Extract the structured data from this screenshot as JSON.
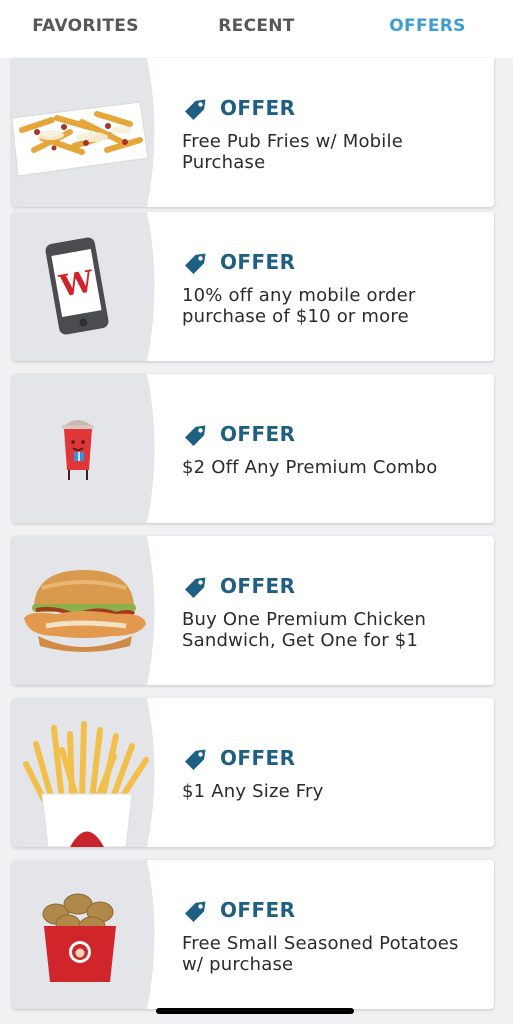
{
  "tabs": [
    {
      "label": "FAVORITES",
      "active": false
    },
    {
      "label": "RECENT",
      "active": false
    },
    {
      "label": "OFFERS",
      "active": true
    }
  ],
  "colors": {
    "accent": "#3e9ed1",
    "offer_text": "#1f5f82",
    "tag_icon": "#1f5f82",
    "media_bg": "#e4e5e8"
  },
  "offers": [
    {
      "label": "OFFER",
      "description": "Free Pub Fries w/ Mobile Purchase",
      "image": "pub-fries-image",
      "tag_icon": "price-tag-icon"
    },
    {
      "label": "OFFER",
      "description": "10% off any mobile order purchase of $10 or more",
      "image": "mobile-phone-w-image",
      "tag_icon": "price-tag-icon"
    },
    {
      "label": "OFFER",
      "description": "$2 Off Any Premium Combo",
      "image": "frosty-cup-mascot-image",
      "tag_icon": "price-tag-icon"
    },
    {
      "label": "OFFER",
      "description": "Buy One Premium Chicken Sandwich, Get One for $1",
      "image": "chicken-sandwich-image",
      "tag_icon": "price-tag-icon"
    },
    {
      "label": "OFFER",
      "description": "$1 Any Size Fry",
      "image": "fries-carton-image",
      "tag_icon": "price-tag-icon"
    },
    {
      "label": "OFFER",
      "description": "Free Small Seasoned Potatoes w/ purchase",
      "image": "seasoned-potatoes-image",
      "tag_icon": "price-tag-icon"
    }
  ]
}
